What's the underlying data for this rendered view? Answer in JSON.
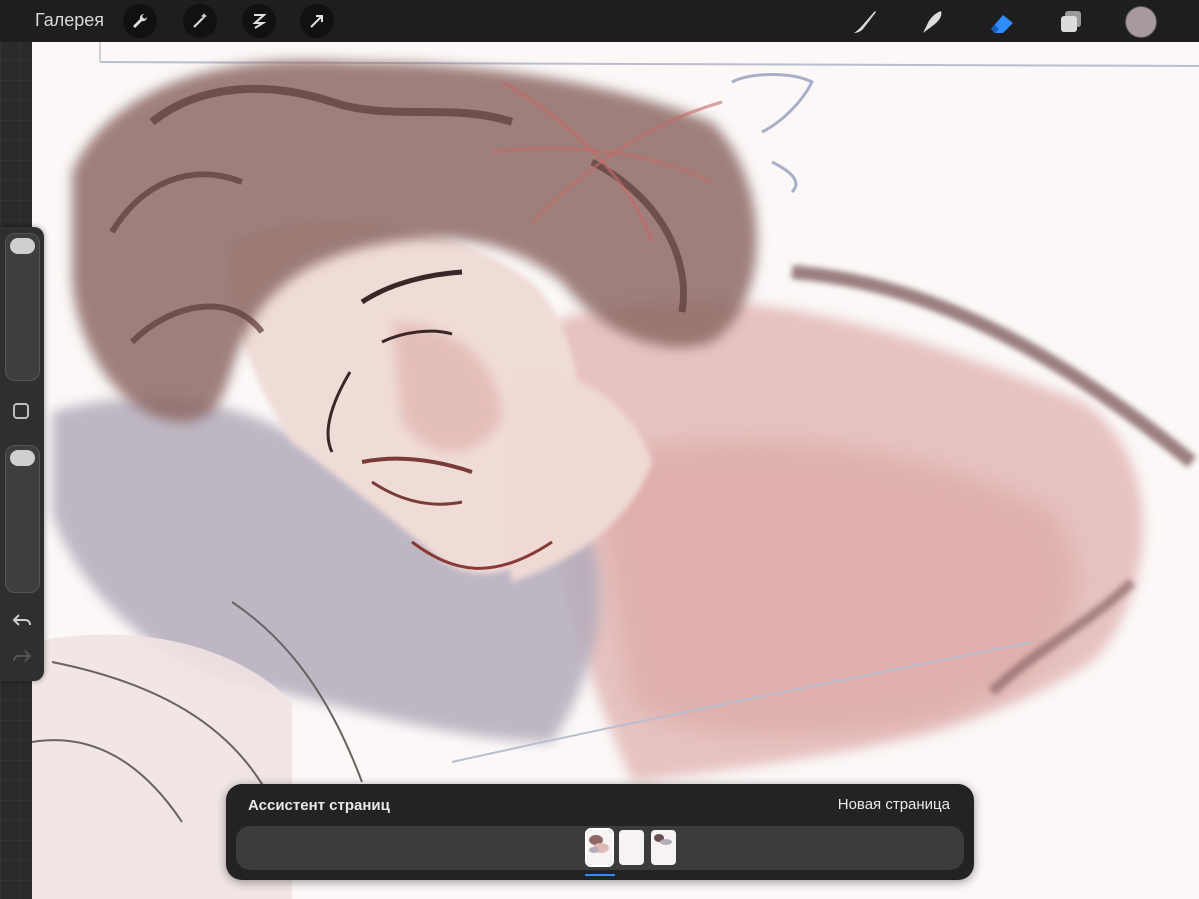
{
  "topbar": {
    "gallery_label": "Галерея",
    "left_tools": [
      {
        "name": "wrench-icon"
      },
      {
        "name": "magic-wand-icon"
      },
      {
        "name": "selection-icon"
      },
      {
        "name": "transform-arrow-icon"
      }
    ],
    "right_tools": [
      {
        "name": "brush-icon"
      },
      {
        "name": "smudge-icon"
      },
      {
        "name": "eraser-icon",
        "active": true
      },
      {
        "name": "layers-icon"
      }
    ],
    "current_color": "#a898a0",
    "active_tool_color": "#2f8cff"
  },
  "sidebar": {
    "brush_size": 0.98,
    "brush_opacity": 0.98
  },
  "page_assistant": {
    "title": "Ассистент страниц",
    "new_page_label": "Новая страница",
    "pages": [
      {
        "name": "page-thumb-1",
        "active": true
      },
      {
        "name": "page-thumb-2",
        "active": false
      },
      {
        "name": "page-thumb-3",
        "active": false
      }
    ]
  }
}
